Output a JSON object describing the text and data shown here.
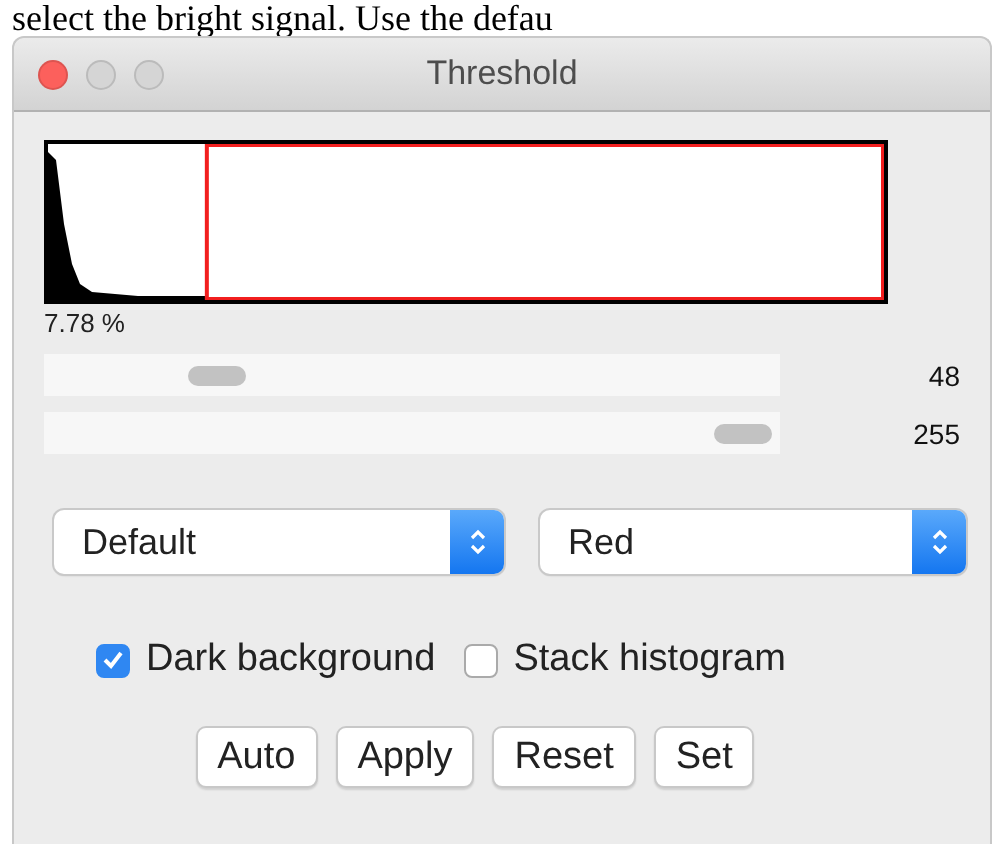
{
  "background_text": "select the bright signal.  Use the defau",
  "window": {
    "title": "Threshold"
  },
  "histogram": {
    "percent": "7.78 %"
  },
  "sliders": [
    {
      "level": 0.19,
      "reading": "48"
    },
    {
      "level": 1,
      "reading": "255"
    }
  ],
  "dropdowns": [
    {
      "value": "Default"
    },
    {
      "value": "Red"
    }
  ],
  "checkboxes": [
    {
      "label": "Dark background",
      "checked": true
    },
    {
      "label": "Stack histogram",
      "checked": false
    }
  ],
  "buttons": [
    "Auto",
    "Apply",
    "Reset",
    "Set"
  ]
}
